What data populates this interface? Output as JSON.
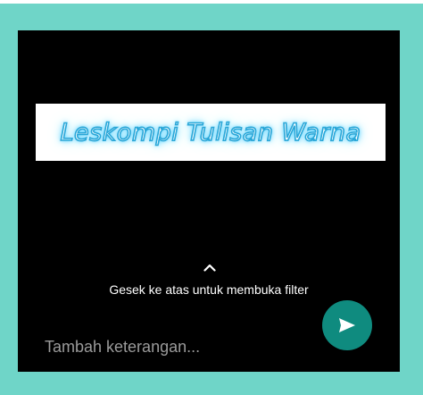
{
  "banner": {
    "text": "Leskompi Tulisan Warna"
  },
  "filter_hint": {
    "chevron_icon": "chevron-up-icon",
    "text": "Gesek ke atas untuk membuka filter"
  },
  "caption": {
    "placeholder": "Tambah keterangan..."
  },
  "send": {
    "icon": "send-icon",
    "color": "#0f8b7f"
  },
  "colors": {
    "frame": "#6fd5c8",
    "screen": "#000000",
    "glow": "#5cd3ff"
  }
}
